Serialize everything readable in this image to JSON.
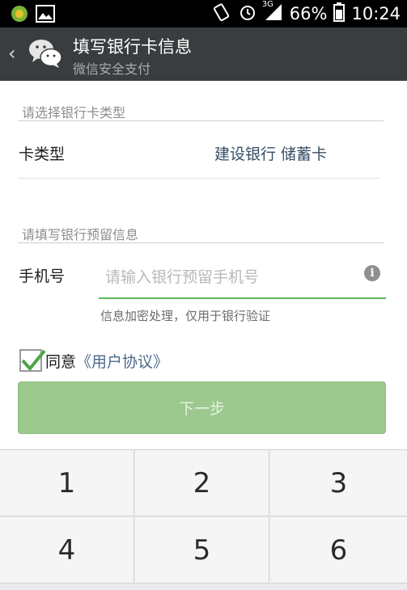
{
  "status_bar": {
    "icons_left": [
      "app-icon",
      "image-icon"
    ],
    "icons_right": [
      "rotation-icon",
      "alarm-icon",
      "3g-signal-icon",
      "battery-icon"
    ],
    "network": "3G",
    "battery": "66%",
    "time": "10:24"
  },
  "action_bar": {
    "back_label": "‹",
    "title": "填写银行卡信息",
    "subtitle": "微信安全支付"
  },
  "card_section": {
    "hint": "请选择银行卡类型",
    "label": "卡类型",
    "value": "建设银行 储蓄卡"
  },
  "phone_section": {
    "hint": "请填写银行预留信息",
    "label": "手机号",
    "value": "",
    "placeholder": "请输入银行预留手机号",
    "info_label": "i",
    "note": "信息加密处理，仅用于银行验证"
  },
  "agreement": {
    "checked": true,
    "text": "同意",
    "link": "《用户协议》"
  },
  "next_button": "下一步",
  "keypad": {
    "keys": [
      "1",
      "2",
      "3",
      "4",
      "5",
      "6"
    ]
  },
  "colors": {
    "status_bar": "#000000",
    "action_bar": "#3a3d3f",
    "accent_green": "#5cb85c",
    "button_disabled": "#9cc98e",
    "link": "#4a6a8c"
  }
}
